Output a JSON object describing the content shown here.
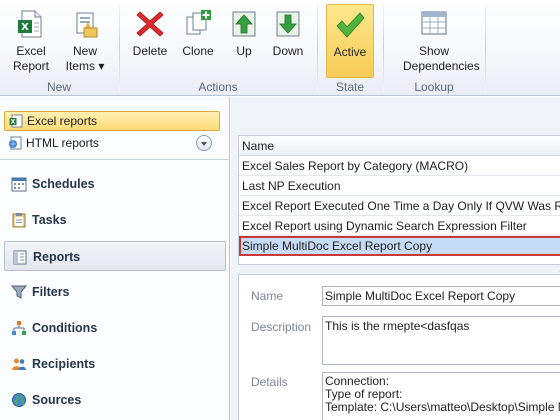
{
  "ribbon": {
    "groups": [
      {
        "label": "New",
        "buttons": [
          {
            "label": "Excel Report"
          },
          {
            "label": "New Items ▾"
          }
        ]
      },
      {
        "label": "Actions",
        "buttons": [
          {
            "label": "Delete"
          },
          {
            "label": "Clone"
          },
          {
            "label": "Up"
          },
          {
            "label": "Down"
          }
        ]
      },
      {
        "label": "State",
        "buttons": [
          {
            "label": "Active"
          }
        ]
      },
      {
        "label": "Lookup",
        "buttons": [
          {
            "label": "Show Dependencies"
          }
        ]
      }
    ]
  },
  "left": {
    "report_types": [
      {
        "label": "Excel reports",
        "icon": "excel-icon",
        "selected": true
      },
      {
        "label": "HTML reports",
        "icon": "html-icon",
        "selected": false
      }
    ],
    "nav": [
      {
        "label": "Schedules",
        "icon": "calendar-icon"
      },
      {
        "label": "Tasks",
        "icon": "clipboard-icon"
      },
      {
        "label": "Reports",
        "icon": "reports-icon",
        "selected": true
      },
      {
        "label": "Filters",
        "icon": "filter-icon"
      },
      {
        "label": "Conditions",
        "icon": "hierarchy-icon"
      },
      {
        "label": "Recipients",
        "icon": "people-icon"
      },
      {
        "label": "Sources",
        "icon": "globe-icon"
      }
    ]
  },
  "list": {
    "column": "Name",
    "rows": [
      "Excel Sales Report by Category (MACRO)",
      "Last NP Execution",
      "Excel Report Executed One Time a Day Only If QVW Was Reloaded",
      "Excel Report using Dynamic Search Expression Filter",
      "Simple MultiDoc Excel Report Copy"
    ],
    "selected_index": 4
  },
  "detail": {
    "name_label": "Name",
    "name_value": "Simple MultiDoc Excel Report Copy",
    "description_label": "Description",
    "description_value": "This is the rmepte<dasfqas",
    "details_label": "Details",
    "details_lines": [
      "Connection:",
      "Type of report:",
      "Template: C:\\Users\\matteo\\Desktop\\Simple MultiDoc Excel Report.xlsx"
    ]
  },
  "colors": {
    "accent": "#f7cb56",
    "selection": "#c7dcf5",
    "selection_border": "#c83a3a"
  }
}
